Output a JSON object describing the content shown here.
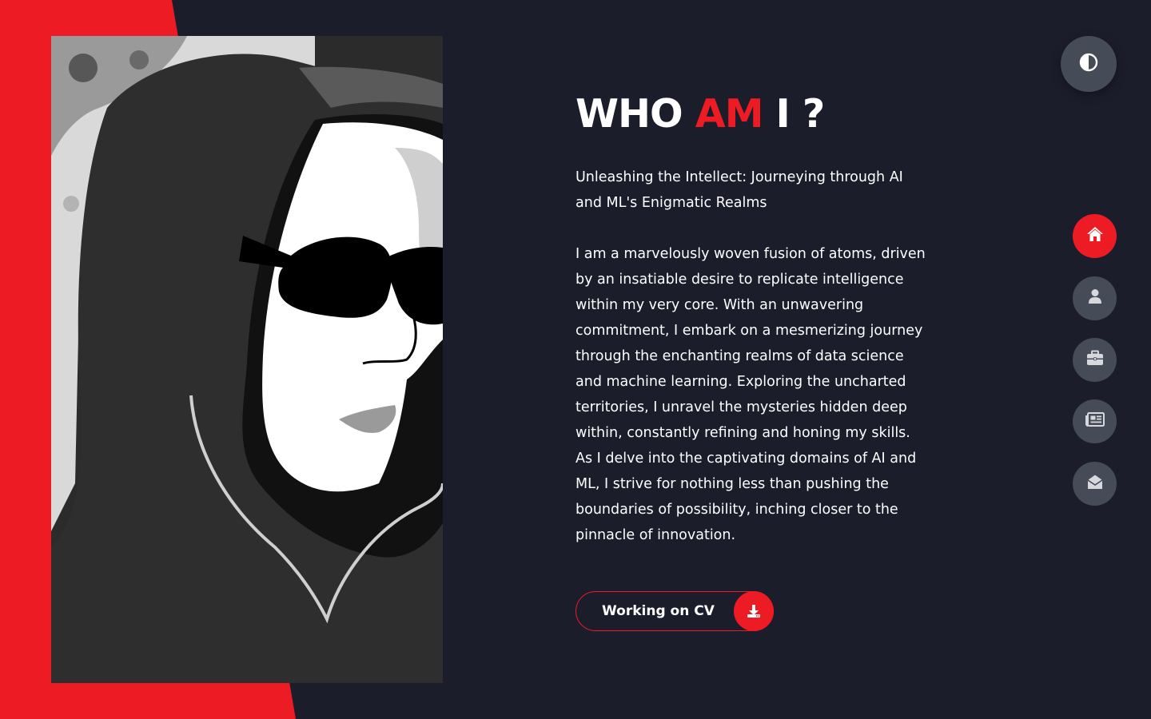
{
  "colors": {
    "accent": "#ed1c24",
    "background": "#1b1d2b",
    "nav_button": "#454b57",
    "text": "#ffffff"
  },
  "hero": {
    "title_part1": "WHO ",
    "title_accent": "AM",
    "title_part2": " I ?",
    "subtitle": "Unleashing the Intellect: Journeying through AI and ML's Enigmatic Realms",
    "bio": "I am a marvelously woven fusion of atoms, driven by an insatiable desire to replicate intelligence within my very core. With an unwavering commitment, I embark on a mesmerizing journey through the enchanting realms of data science and machine learning. Exploring the uncharted territories, I unravel the mysteries hidden deep within, constantly refining and honing my skills. As I delve into the captivating domains of AI and ML, I strive for nothing less than pushing the boundaries of possibility, inching closer to the pinnacle of innovation."
  },
  "cv_button": {
    "label": "Working on CV",
    "icon": "download-icon"
  },
  "theme_toggle": {
    "icon": "contrast-icon"
  },
  "nav": [
    {
      "id": "home",
      "icon": "home-icon",
      "active": true
    },
    {
      "id": "about",
      "icon": "user-icon",
      "active": false
    },
    {
      "id": "portfolio",
      "icon": "briefcase-icon",
      "active": false
    },
    {
      "id": "blog",
      "icon": "newspaper-icon",
      "active": false
    },
    {
      "id": "contact",
      "icon": "envelope-open-icon",
      "active": false
    }
  ]
}
